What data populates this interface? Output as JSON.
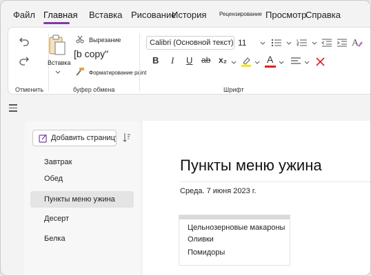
{
  "menu": {
    "tabs": [
      "Файл",
      "Главная",
      "Вставка",
      "Рисование",
      "История",
      "Рецензирование",
      "Просмотр",
      "Справка"
    ],
    "active": "Главная"
  },
  "ribbon": {
    "undo_group_label": "Отменить",
    "clipboard": {
      "paste_label": "Вставка",
      "cut_label": "Вырезание",
      "copy_label": "[b copy\"",
      "format_painter_label": "Форматирование paint",
      "group_label": "буфер обмена"
    },
    "font": {
      "font_name": "Calibri (Основной текст)",
      "font_size": "11",
      "group_label": "Шрифт",
      "bold": "B",
      "italic": "I",
      "underline": "U",
      "strike": "ab",
      "subscript": "x₂",
      "font_color_letter": "A"
    },
    "colors": {
      "highlight": "#f5e800",
      "font_color": "#e0201b",
      "accent": "#7b3aa6"
    }
  },
  "pages": {
    "add_label": "Добавить страницу",
    "items": [
      "Завтрак",
      "Обед",
      "Пункты меню ужина",
      "Десерт",
      "Белка"
    ],
    "selected_index": 2
  },
  "page": {
    "title": "Пункты меню ужина",
    "date": "Среда. 7 июня 2023 г.",
    "note_lines": [
      "Цельнозерновые макароны",
      "Оливки",
      "Помидоры"
    ]
  }
}
